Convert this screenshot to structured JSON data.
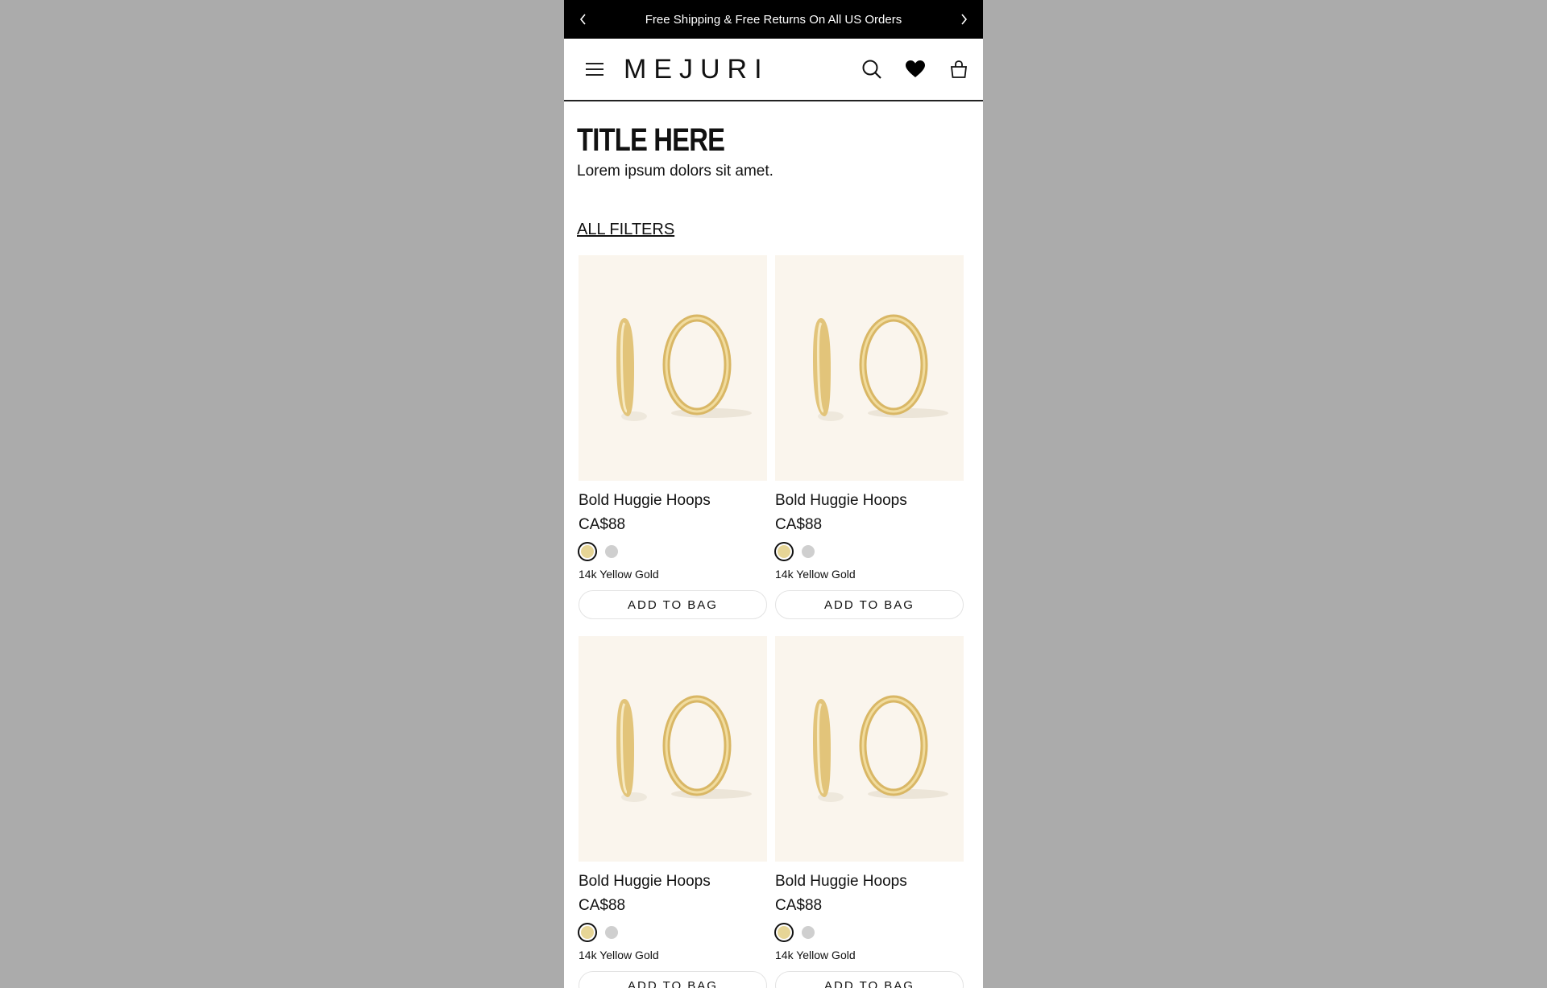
{
  "promo_bar": {
    "text": "Free Shipping & Free Returns On All US Orders",
    "prev_icon": "chevron-left-icon",
    "next_icon": "chevron-right-icon"
  },
  "header": {
    "logo": "MEJURI",
    "icons": [
      "menu-icon",
      "search-icon",
      "heart-icon",
      "shopping-bag-icon"
    ]
  },
  "page": {
    "title": "TITLE HERE",
    "subtitle": "Lorem ipsum dolors sit amet.",
    "filters_label": "ALL FILTERS"
  },
  "products": [
    {
      "name": "Bold Huggie Hoops",
      "price": "CA$88",
      "variant": "14k Yellow Gold",
      "cta": "ADD TO BAG"
    },
    {
      "name": "Bold Huggie Hoops",
      "price": "CA$88",
      "variant": "14k Yellow Gold",
      "cta": "ADD TO BAG"
    },
    {
      "name": "Bold Huggie Hoops",
      "price": "CA$88",
      "variant": "14k Yellow Gold",
      "cta": "ADD TO BAG"
    },
    {
      "name": "Bold Huggie Hoops",
      "price": "CA$88",
      "variant": "14k Yellow Gold",
      "cta": "ADD TO BAG"
    }
  ],
  "colors": {
    "promo_bg": "#000000",
    "image_bg": "#faf5ed",
    "swatch_gold": "#e6d596",
    "swatch_silver": "#cfcfcf"
  }
}
